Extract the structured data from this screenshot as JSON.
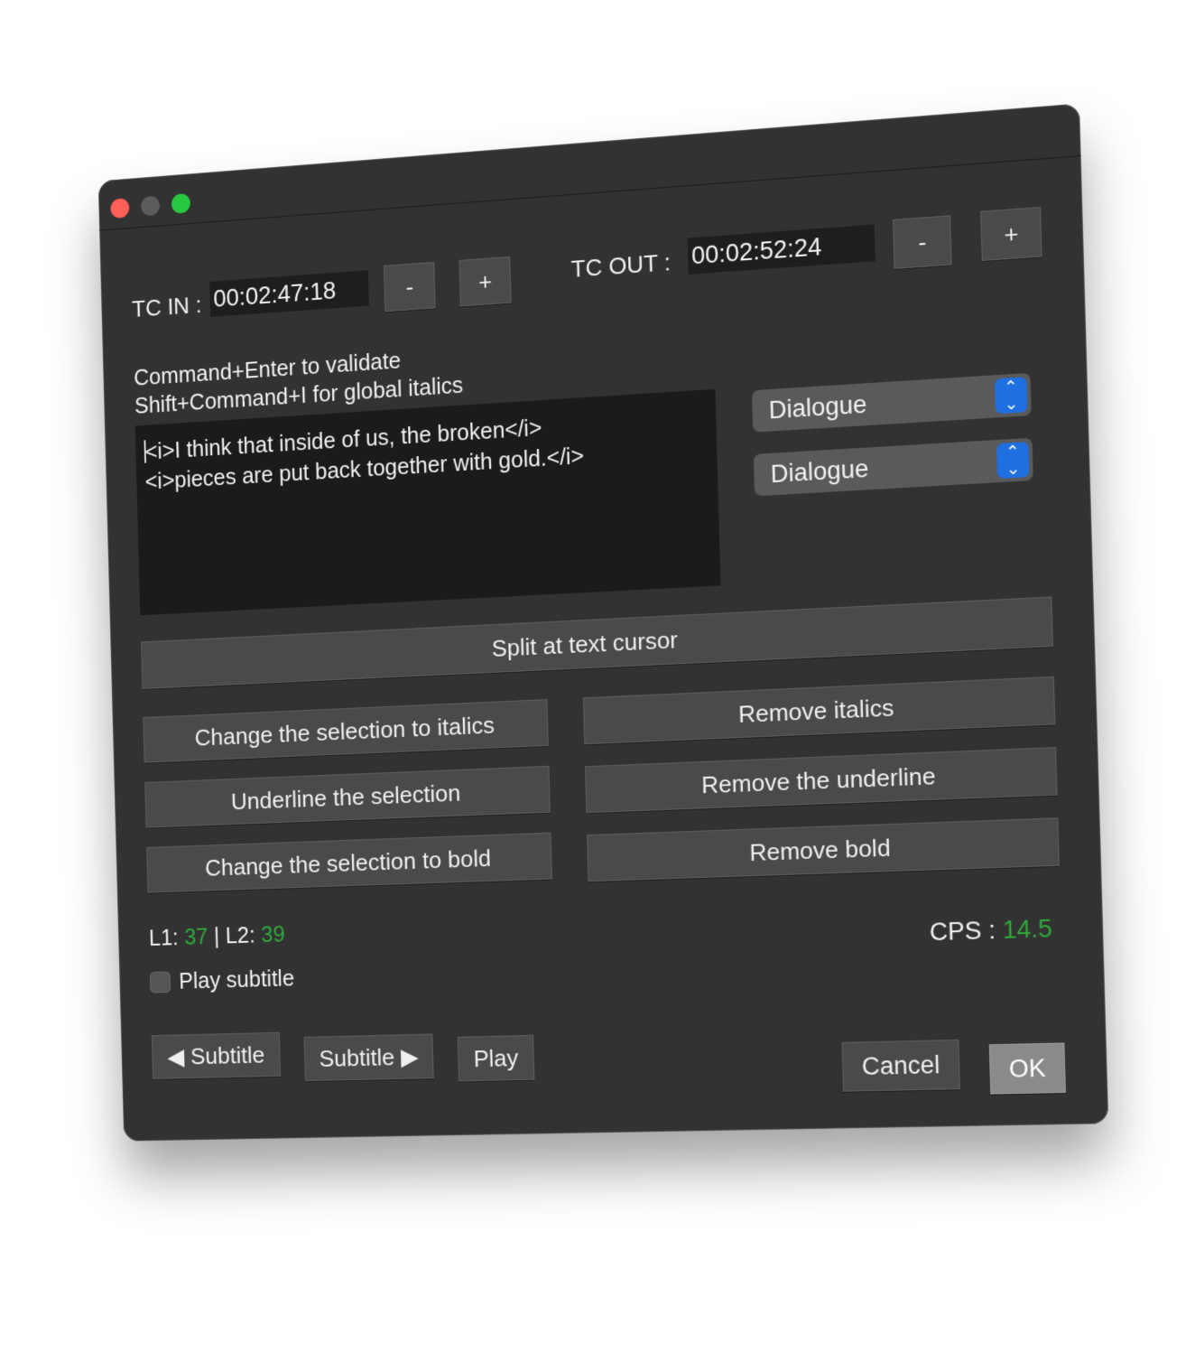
{
  "tc_in": {
    "label": "TC IN :",
    "value": "00:02:47:18",
    "minus": "-",
    "plus": "+"
  },
  "tc_out": {
    "label": "TC OUT :",
    "value": "00:02:52:24",
    "minus": "-",
    "plus": "+"
  },
  "hints": {
    "line1": "Command+Enter to validate",
    "line2": "Shift+Command+I for global italics"
  },
  "editor": {
    "line1": "<i>I think that inside of us, the broken</i>",
    "line2": "<i>pieces are put back together with gold.</i>"
  },
  "selects": {
    "first": "Dialogue",
    "second": "Dialogue"
  },
  "buttons": {
    "split": "Split at text cursor",
    "italics": "Change the selection to italics",
    "remove_italics": "Remove italics",
    "underline": "Underline the selection",
    "remove_underline": "Remove the underline",
    "bold": "Change the selection to bold",
    "remove_bold": "Remove bold",
    "prev_subtitle": "◀ Subtitle",
    "next_subtitle": "Subtitle ▶",
    "play": "Play",
    "cancel": "Cancel",
    "ok": "OK"
  },
  "stats": {
    "l1_label": "L1: ",
    "l1_value": "37",
    "sep": " | L2: ",
    "l2_value": "39",
    "cps_label": "CPS : ",
    "cps_value": "14.5",
    "value_color": "#2fa83a"
  },
  "play_subtitle": {
    "label": "Play subtitle",
    "checked": false
  }
}
